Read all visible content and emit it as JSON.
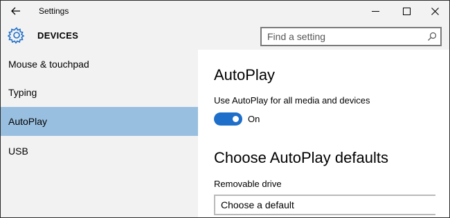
{
  "window": {
    "title": "Settings",
    "icons": {
      "back": "back-arrow-icon",
      "minimize": "minimize-icon",
      "maximize": "maximize-icon",
      "close": "close-icon"
    }
  },
  "header": {
    "title": "DEVICES",
    "icon": "gear-icon",
    "search": {
      "placeholder": "Find a setting",
      "value": "",
      "icon": "search-icon"
    }
  },
  "sidebar": {
    "items": [
      {
        "label": "Mouse & touchpad",
        "selected": false
      },
      {
        "label": "Typing",
        "selected": false
      },
      {
        "label": "AutoPlay",
        "selected": true
      },
      {
        "label": "USB",
        "selected": false
      }
    ]
  },
  "main": {
    "heading": "AutoPlay",
    "toggle": {
      "description": "Use AutoPlay for all media and devices",
      "state_label": "On",
      "on": true
    },
    "defaults_heading": "Choose AutoPlay defaults",
    "removable_drive": {
      "label": "Removable drive",
      "value": "Choose a default"
    }
  },
  "colors": {
    "accent": "#1e6fc9",
    "selected_nav": "#99bfe0",
    "chrome_bg": "#f2f2f2",
    "content_bg": "#ffffff"
  }
}
